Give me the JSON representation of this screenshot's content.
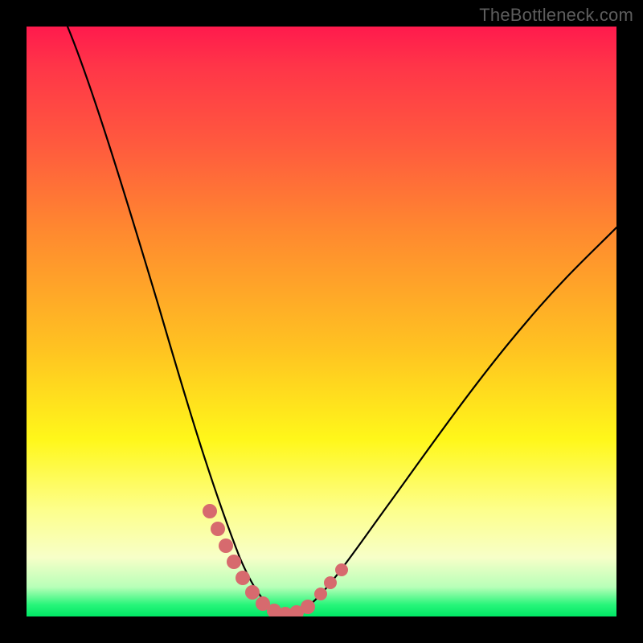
{
  "watermark": "TheBottleneck.com",
  "colors": {
    "frame": "#000000",
    "curve": "#000000",
    "marker": "#d76a6e",
    "gradient_top": "#ff1a4d",
    "gradient_bottom": "#00e765"
  },
  "chart_data": {
    "type": "line",
    "title": "",
    "xlabel": "",
    "ylabel": "",
    "xlim": [
      0,
      100
    ],
    "ylim": [
      0,
      100
    ],
    "grid": false,
    "legend": false,
    "series": [
      {
        "name": "bottleneck-curve",
        "x": [
          7,
          10,
          14,
          18,
          22,
          26,
          30,
          33,
          36,
          38,
          40,
          42,
          44,
          46,
          50,
          54,
          58,
          62,
          68,
          74,
          80,
          88,
          96,
          100
        ],
        "y": [
          100,
          88,
          74,
          60,
          47,
          35,
          24,
          16,
          10,
          6,
          3,
          1,
          0,
          1,
          4,
          9,
          15,
          21,
          29,
          37,
          45,
          54,
          63,
          67
        ]
      }
    ],
    "markers": {
      "name": "highlight-dots",
      "x": [
        31.5,
        33,
        34.5,
        36,
        38,
        40,
        42,
        44,
        46,
        48,
        50,
        51.5
      ],
      "y": [
        18,
        14,
        10.5,
        7.5,
        4.5,
        2.5,
        1,
        0.5,
        1,
        3,
        5,
        7.5
      ]
    }
  }
}
